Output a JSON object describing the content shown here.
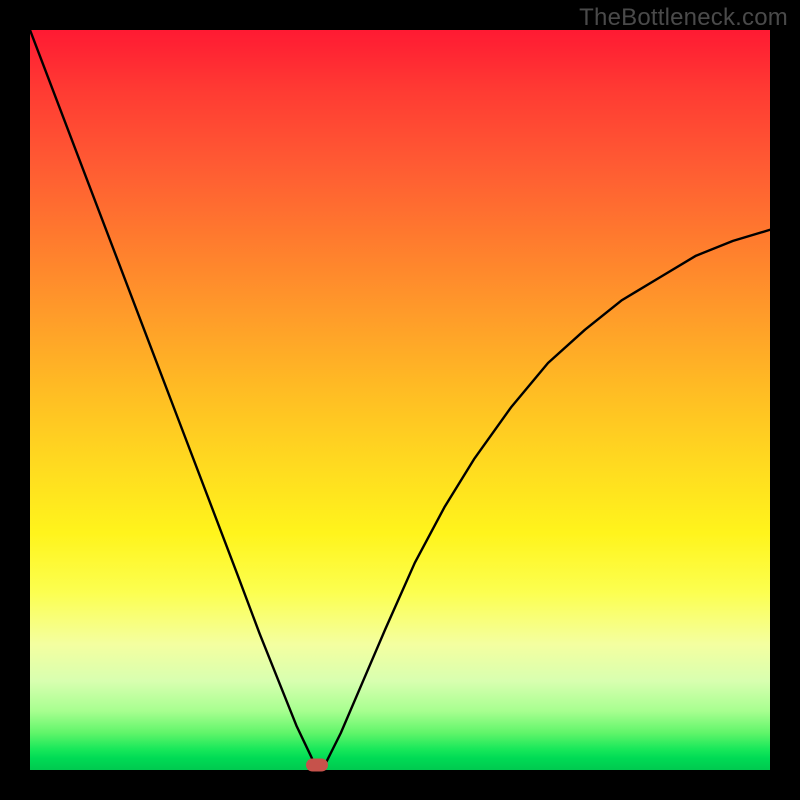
{
  "watermark": "TheBottleneck.com",
  "chart_data": {
    "type": "line",
    "title": "",
    "xlabel": "",
    "ylabel": "",
    "xlim": [
      0,
      1
    ],
    "ylim": [
      0,
      1
    ],
    "note": "y represents mismatch/bottleneck fraction (0 at bottom=green, 1 at top=red). The curve drops from the top-left, touches ~0 near x≈0.388, then rises toward the right edge (~0.73 at x=1). An orange marker sits at the curve minimum.",
    "series": [
      {
        "name": "bottleneck-curve",
        "x": [
          0.0,
          0.04,
          0.08,
          0.12,
          0.16,
          0.2,
          0.24,
          0.28,
          0.31,
          0.34,
          0.36,
          0.38,
          0.388,
          0.4,
          0.42,
          0.45,
          0.48,
          0.52,
          0.56,
          0.6,
          0.65,
          0.7,
          0.75,
          0.8,
          0.85,
          0.9,
          0.95,
          1.0
        ],
        "values": [
          1.0,
          0.895,
          0.79,
          0.685,
          0.58,
          0.475,
          0.37,
          0.265,
          0.185,
          0.11,
          0.06,
          0.018,
          0.0,
          0.01,
          0.05,
          0.12,
          0.19,
          0.28,
          0.355,
          0.42,
          0.49,
          0.55,
          0.595,
          0.635,
          0.665,
          0.695,
          0.715,
          0.73
        ]
      }
    ],
    "marker": {
      "x": 0.388,
      "y": 0.007
    },
    "background_gradient": {
      "top": "#ff1a33",
      "bottom": "#00c94f",
      "stops": [
        "red",
        "orange",
        "yellow",
        "green"
      ]
    }
  }
}
